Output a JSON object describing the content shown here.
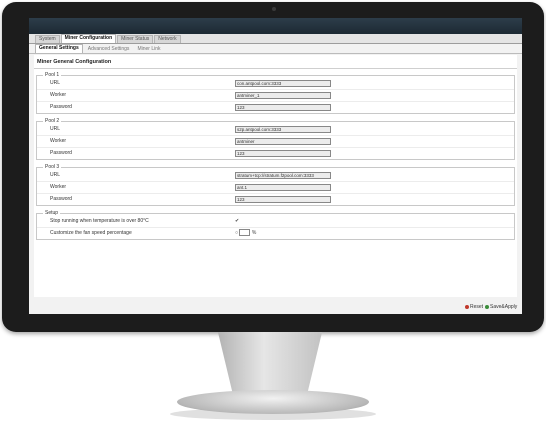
{
  "main_tabs": [
    "System",
    "Miner Configuration",
    "Miner Status",
    "Network"
  ],
  "sub_tabs": [
    "General Settings",
    "Advanced Settings",
    "Miner Link"
  ],
  "section_title": "Miner General Configuration",
  "pools": [
    {
      "legend": "Pool 1",
      "url_label": "URL",
      "url_value": "con.antpool.com:3333",
      "worker_label": "Worker",
      "worker_value": "antminer_1",
      "password_label": "Password",
      "password_value": "123"
    },
    {
      "legend": "Pool 2",
      "url_label": "URL",
      "url_value": "s2p.antpool.com:3333",
      "worker_label": "Worker",
      "worker_value": "antminer",
      "password_label": "Password",
      "password_value": "123"
    },
    {
      "legend": "Pool 3",
      "url_label": "URL",
      "url_value": "stratum+tcp://stratum.f2pool.com:3333",
      "worker_label": "Worker",
      "worker_value": "ant.1",
      "password_label": "Password",
      "password_value": "123"
    }
  ],
  "setup": {
    "legend": "Setup",
    "stop_label": "Stop running when temperature is over 80°C",
    "stop_check": "✔",
    "fan_label": "Customize the fan speed percentage",
    "fan_prefix": "○",
    "fan_unit": "%"
  },
  "footer": {
    "reset": "Reset",
    "save": "Save&Apply"
  },
  "colors": {
    "reset_icon": "#c0392b",
    "save_icon": "#3a8c3a"
  }
}
